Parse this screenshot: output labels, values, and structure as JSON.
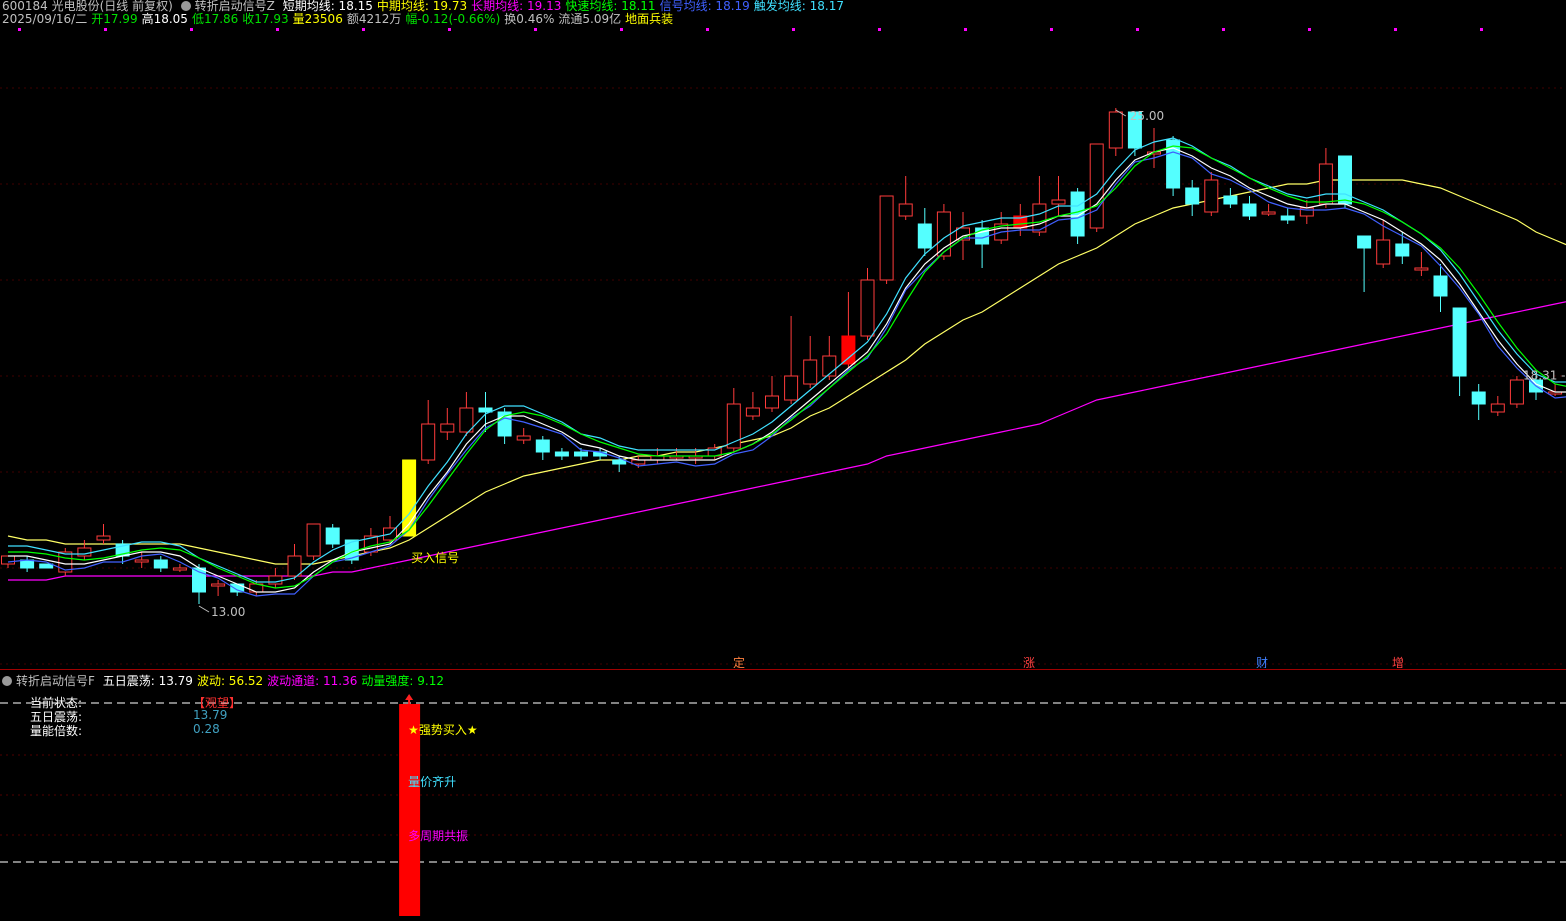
{
  "header": {
    "code_name": "600184 光电股份(日线 前复权)",
    "indicator_name": "转折启动信号Z",
    "ma": [
      {
        "label": "短期均线: 18.15",
        "color": "#ffffff"
      },
      {
        "label": "中期均线: 19.73",
        "color": "#ffff00"
      },
      {
        "label": "长期均线: 19.13",
        "color": "#ff00ff"
      },
      {
        "label": "快速均线: 18.11",
        "color": "#00ff00"
      },
      {
        "label": "信号均线: 18.19",
        "color": "#4060ff"
      },
      {
        "label": "触发均线: 18.17",
        "color": "#40e0ff"
      }
    ],
    "quote": [
      {
        "label": "2025/09/16/二",
        "color": "#c0c0c0"
      },
      {
        "label": "开17.99",
        "color": "#00e000"
      },
      {
        "label": "高18.05",
        "color": "#ffffff"
      },
      {
        "label": "低17.86",
        "color": "#00e000"
      },
      {
        "label": "收17.93",
        "color": "#00e000"
      },
      {
        "label": "量23506",
        "color": "#ffff00"
      },
      {
        "label": "额4212万",
        "color": "#c0c0c0"
      },
      {
        "label": "幅-0.12(-0.66%)",
        "color": "#00e000"
      },
      {
        "label": "换0.46%",
        "color": "#c0c0c0"
      },
      {
        "label": "流通5.09亿",
        "color": "#c0c0c0"
      },
      {
        "label": "地面兵装",
        "color": "#ffff00"
      }
    ]
  },
  "chart_data": {
    "type": "candlestick",
    "title": "",
    "y_range": [
      11.0,
      27.0
    ],
    "high_label": "25.00",
    "low_label": "13.00",
    "last_label": "18.31",
    "signal_label": "买入信号",
    "event_labels": [
      "定",
      "涨",
      "财",
      "增"
    ],
    "candles": [
      [
        13.6,
        13.8,
        13.5,
        13.7
      ],
      [
        13.7,
        13.5,
        13.4,
        13.8
      ],
      [
        13.6,
        13.5,
        13.5,
        13.6
      ],
      [
        13.4,
        13.9,
        13.3,
        14.0
      ],
      [
        13.8,
        14.0,
        13.7,
        14.2
      ],
      [
        14.2,
        14.3,
        14.1,
        14.6
      ],
      [
        14.1,
        13.8,
        13.6,
        14.2
      ],
      [
        13.7,
        13.7,
        13.5,
        13.9
      ],
      [
        13.7,
        13.5,
        13.4,
        13.8
      ],
      [
        13.5,
        13.5,
        13.4,
        13.6
      ],
      [
        13.5,
        12.9,
        12.6,
        13.6
      ],
      [
        13.1,
        13.1,
        12.8,
        13.2
      ],
      [
        13.1,
        12.9,
        12.8,
        13.1
      ],
      [
        12.9,
        13.1,
        12.8,
        13.2
      ],
      [
        13.1,
        13.3,
        13.0,
        13.5
      ],
      [
        13.3,
        13.8,
        13.2,
        14.1
      ],
      [
        13.8,
        14.6,
        13.7,
        14.6
      ],
      [
        14.5,
        14.1,
        14.0,
        14.6
      ],
      [
        14.2,
        13.7,
        13.6,
        14.2
      ],
      [
        13.9,
        14.3,
        13.8,
        14.5
      ],
      [
        14.2,
        14.5,
        14.1,
        14.8
      ],
      [
        14.3,
        16.2,
        14.3,
        16.2
      ],
      [
        16.2,
        17.1,
        16.1,
        17.7
      ],
      [
        16.9,
        17.1,
        16.7,
        17.5
      ],
      [
        16.9,
        17.5,
        16.8,
        17.9
      ],
      [
        17.5,
        17.4,
        16.9,
        17.9
      ],
      [
        17.4,
        16.8,
        16.6,
        17.5
      ],
      [
        16.7,
        16.8,
        16.6,
        17.0
      ],
      [
        16.7,
        16.4,
        16.2,
        16.8
      ],
      [
        16.4,
        16.3,
        16.2,
        16.5
      ],
      [
        16.4,
        16.3,
        16.2,
        16.5
      ],
      [
        16.4,
        16.3,
        16.2,
        16.5
      ],
      [
        16.2,
        16.1,
        15.9,
        16.3
      ],
      [
        16.1,
        16.2,
        16.0,
        16.3
      ],
      [
        16.2,
        16.3,
        16.1,
        16.5
      ],
      [
        16.3,
        16.3,
        16.2,
        16.5
      ],
      [
        16.3,
        16.3,
        16.1,
        16.5
      ],
      [
        16.3,
        16.5,
        16.2,
        16.6
      ],
      [
        16.5,
        17.6,
        16.4,
        18.0
      ],
      [
        17.3,
        17.5,
        17.2,
        17.9
      ],
      [
        17.5,
        17.8,
        17.4,
        18.3
      ],
      [
        17.7,
        18.3,
        17.6,
        19.8
      ],
      [
        18.1,
        18.7,
        18.0,
        19.3
      ],
      [
        18.3,
        18.8,
        18.2,
        19.3
      ],
      [
        18.6,
        19.3,
        18.5,
        20.4
      ],
      [
        19.3,
        20.7,
        19.2,
        21.0
      ],
      [
        20.7,
        22.8,
        20.6,
        22.8
      ],
      [
        22.3,
        22.6,
        22.2,
        23.3
      ],
      [
        22.1,
        21.5,
        21.3,
        22.5
      ],
      [
        21.3,
        22.4,
        21.2,
        22.6
      ],
      [
        21.7,
        22.0,
        21.2,
        22.4
      ],
      [
        22.0,
        21.6,
        21.0,
        22.2
      ],
      [
        21.7,
        22.1,
        21.6,
        22.4
      ],
      [
        22.0,
        22.3,
        21.8,
        22.6
      ],
      [
        21.9,
        22.6,
        21.8,
        23.3
      ],
      [
        22.6,
        22.7,
        22.3,
        23.3
      ],
      [
        22.9,
        21.8,
        21.6,
        23.0
      ],
      [
        22.0,
        24.1,
        21.9,
        24.1
      ],
      [
        24.0,
        24.9,
        23.8,
        25.0
      ],
      [
        24.9,
        24.0,
        23.8,
        24.9
      ],
      [
        23.9,
        23.9,
        23.5,
        24.5
      ],
      [
        24.2,
        23.0,
        22.8,
        24.3
      ],
      [
        23.0,
        22.6,
        22.3,
        23.2
      ],
      [
        22.4,
        23.2,
        22.3,
        23.4
      ],
      [
        22.8,
        22.6,
        22.5,
        23.0
      ],
      [
        22.6,
        22.3,
        22.2,
        22.8
      ],
      [
        22.4,
        22.4,
        22.3,
        22.6
      ],
      [
        22.3,
        22.2,
        22.1,
        22.5
      ],
      [
        22.3,
        22.5,
        22.1,
        22.7
      ],
      [
        22.6,
        23.6,
        22.5,
        24.0
      ],
      [
        23.8,
        22.6,
        22.5,
        23.8
      ],
      [
        21.8,
        21.5,
        20.4,
        21.8
      ],
      [
        21.1,
        21.7,
        21.0,
        22.2
      ],
      [
        21.6,
        21.3,
        21.1,
        21.9
      ],
      [
        21.0,
        21.0,
        20.8,
        21.4
      ],
      [
        20.8,
        20.3,
        19.9,
        21.1
      ],
      [
        20.0,
        18.3,
        17.8,
        20.0
      ],
      [
        17.9,
        17.6,
        17.2,
        18.1
      ],
      [
        17.4,
        17.6,
        17.3,
        17.8
      ],
      [
        17.6,
        18.2,
        17.5,
        18.3
      ],
      [
        18.2,
        17.9,
        17.7,
        18.3
      ],
      [
        17.9,
        17.9,
        17.8,
        18.1
      ],
      [
        17.9,
        18.2,
        17.8,
        18.5
      ],
      [
        18.2,
        18.3,
        18.1,
        18.4
      ],
      [
        18.3,
        18.1,
        17.9,
        18.4
      ],
      [
        17.9,
        17.9,
        17.9,
        18.0
      ]
    ],
    "ma_short": [
      13.8,
      13.8,
      13.7,
      13.6,
      13.6,
      13.7,
      13.8,
      13.9,
      13.9,
      13.8,
      13.5,
      13.3,
      13.1,
      12.9,
      12.9,
      13.0,
      13.4,
      13.7,
      13.9,
      14.0,
      14.1,
      14.6,
      15.3,
      15.9,
      16.6,
      17.1,
      17.3,
      17.3,
      17.1,
      16.9,
      16.6,
      16.5,
      16.3,
      16.2,
      16.2,
      16.2,
      16.2,
      16.2,
      16.4,
      16.6,
      16.9,
      17.3,
      17.7,
      18.1,
      18.5,
      18.9,
      19.6,
      20.5,
      21.1,
      21.5,
      21.8,
      21.9,
      22.0,
      22.0,
      22.1,
      22.3,
      22.3,
      22.6,
      23.2,
      23.7,
      23.9,
      24.0,
      23.8,
      23.5,
      23.3,
      23.0,
      22.8,
      22.6,
      22.5,
      22.6,
      22.6,
      22.4,
      22.2,
      21.9,
      21.6,
      21.2,
      20.6,
      19.9,
      19.2,
      18.6,
      18.1,
      17.9,
      17.9,
      18.0,
      18.1,
      18.1
    ],
    "ma_mid": [
      14.3,
      14.2,
      14.2,
      14.1,
      14.1,
      14.1,
      14.1,
      14.1,
      14.1,
      14.1,
      14.0,
      13.9,
      13.8,
      13.7,
      13.6,
      13.6,
      13.6,
      13.7,
      13.8,
      13.9,
      14.0,
      14.2,
      14.5,
      14.8,
      15.1,
      15.4,
      15.6,
      15.8,
      15.9,
      16.0,
      16.1,
      16.2,
      16.2,
      16.3,
      16.3,
      16.4,
      16.4,
      16.5,
      16.6,
      16.7,
      16.8,
      17.0,
      17.3,
      17.5,
      17.8,
      18.1,
      18.4,
      18.7,
      19.1,
      19.4,
      19.7,
      19.9,
      20.2,
      20.5,
      20.8,
      21.1,
      21.3,
      21.5,
      21.8,
      22.1,
      22.3,
      22.5,
      22.6,
      22.7,
      22.8,
      22.9,
      23.0,
      23.1,
      23.1,
      23.2,
      23.2,
      23.2,
      23.2,
      23.2,
      23.1,
      23.0,
      22.8,
      22.6,
      22.4,
      22.2,
      21.9,
      21.7,
      21.5,
      21.2,
      21.0,
      20.8
    ],
    "ma_long": [
      13.2,
      13.2,
      13.2,
      13.3,
      13.3,
      13.3,
      13.3,
      13.3,
      13.3,
      13.3,
      13.3,
      13.3,
      13.3,
      13.3,
      13.3,
      13.3,
      13.3,
      13.4,
      13.4,
      13.5,
      13.6,
      13.7,
      13.8,
      13.9,
      14.0,
      14.1,
      14.2,
      14.3,
      14.4,
      14.5,
      14.6,
      14.7,
      14.8,
      14.9,
      15.0,
      15.1,
      15.2,
      15.3,
      15.4,
      15.5,
      15.6,
      15.7,
      15.8,
      15.9,
      16.0,
      16.1,
      16.3,
      16.4,
      16.5,
      16.6,
      16.7,
      16.8,
      16.9,
      17.0,
      17.1,
      17.3,
      17.5,
      17.7,
      17.8,
      17.9,
      18.0,
      18.1,
      18.2,
      18.3,
      18.4,
      18.5,
      18.6,
      18.7,
      18.8,
      18.9,
      19.0,
      19.1,
      19.2,
      19.3,
      19.4,
      19.5,
      19.6,
      19.7,
      19.8,
      19.9,
      20.0,
      20.1,
      20.2,
      20.3,
      20.4,
      20.5
    ],
    "buy_bar_index": 21,
    "strong_bar_indices": [
      44,
      53
    ]
  },
  "indicator": {
    "title": "转折启动信号F",
    "values": [
      {
        "label": "五日震荡: 13.79",
        "color": "#ffffff"
      },
      {
        "label": "波动: 56.52",
        "color": "#ffff00"
      },
      {
        "label": "波动通道: 11.36",
        "color": "#ff00ff"
      },
      {
        "label": "动量强度: 9.12",
        "color": "#00ff00"
      }
    ],
    "stats": [
      {
        "name": "当前状态:",
        "value": "【观望】",
        "value_color": "#ff3030"
      },
      {
        "name": "五日震荡:",
        "value": "13.79",
        "value_color": "#40a0c0"
      },
      {
        "name": "量能倍数:",
        "value": "0.28",
        "value_color": "#40a0c0"
      }
    ],
    "signal_texts": [
      {
        "text": "★强势买入★",
        "color": "#ffff00"
      },
      {
        "text": "量价齐升",
        "color": "#40e0ff"
      },
      {
        "text": "多周期共振",
        "color": "#ff00ff"
      }
    ]
  }
}
